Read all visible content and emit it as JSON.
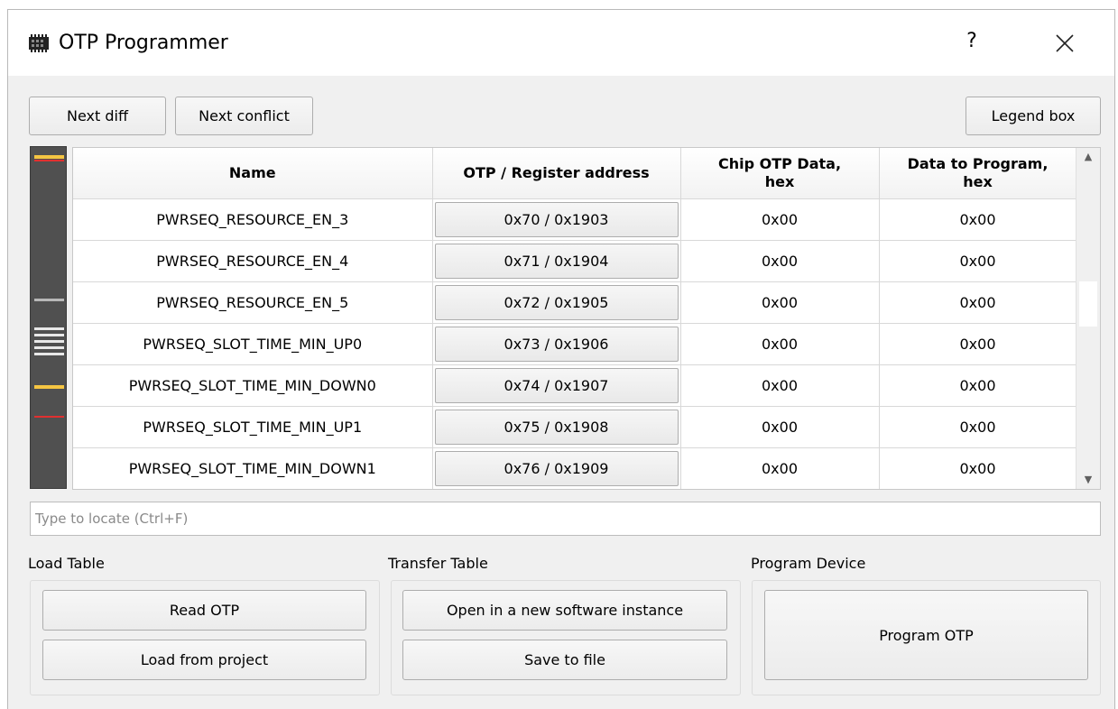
{
  "window": {
    "title": "OTP Programmer",
    "help": "?",
    "icon": "chip-icon",
    "close_icon": "close-icon"
  },
  "toolbar": {
    "next_diff": "Next diff",
    "next_conflict": "Next conflict",
    "legend_box": "Legend box"
  },
  "table": {
    "columns": [
      "Name",
      "OTP / Register address",
      "Chip OTP Data,\nhex",
      "Data to Program,\nhex"
    ],
    "rows": [
      {
        "name": "PWRSEQ_RESOURCE_EN_3",
        "address": "0x70 / 0x1903",
        "chip_data": "0x00",
        "program_data": "0x00"
      },
      {
        "name": "PWRSEQ_RESOURCE_EN_4",
        "address": "0x71 / 0x1904",
        "chip_data": "0x00",
        "program_data": "0x00"
      },
      {
        "name": "PWRSEQ_RESOURCE_EN_5",
        "address": "0x72 / 0x1905",
        "chip_data": "0x00",
        "program_data": "0x00"
      },
      {
        "name": "PWRSEQ_SLOT_TIME_MIN_UP0",
        "address": "0x73 / 0x1906",
        "chip_data": "0x00",
        "program_data": "0x00"
      },
      {
        "name": "PWRSEQ_SLOT_TIME_MIN_DOWN0",
        "address": "0x74 / 0x1907",
        "chip_data": "0x00",
        "program_data": "0x00"
      },
      {
        "name": "PWRSEQ_SLOT_TIME_MIN_UP1",
        "address": "0x75 / 0x1908",
        "chip_data": "0x00",
        "program_data": "0x00"
      },
      {
        "name": "PWRSEQ_SLOT_TIME_MIN_DOWN1",
        "address": "0x76 / 0x1909",
        "chip_data": "0x00",
        "program_data": "0x00"
      }
    ]
  },
  "minimap": {
    "colors": {
      "yellow": "#f5c542",
      "red": "#e03030",
      "white": "#e8e8e8",
      "gray": "#b8b8b8",
      "track": "#505050"
    }
  },
  "search": {
    "placeholder": "Type to locate (Ctrl+F)"
  },
  "load_table": {
    "label": "Load Table",
    "read_otp": "Read OTP",
    "load_from_project": "Load from project"
  },
  "transfer_table": {
    "label": "Transfer Table",
    "open_new_instance": "Open in a new software instance",
    "save_to_file": "Save to file"
  },
  "program_device": {
    "label": "Program Device",
    "program_otp": "Program OTP"
  }
}
